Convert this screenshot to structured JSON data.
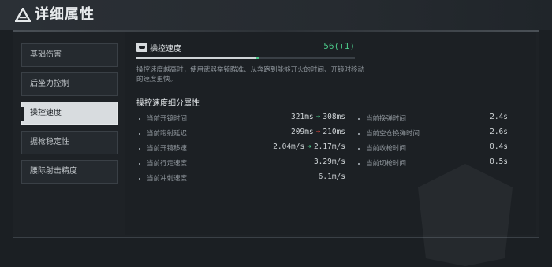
{
  "header": {
    "title": "详细属性",
    "icon": "warning-triangle-icon"
  },
  "sidebar": {
    "items": [
      {
        "label": "基础伤害",
        "active": false
      },
      {
        "label": "后坐力控制",
        "active": false
      },
      {
        "label": "操控速度",
        "active": true
      },
      {
        "label": "据枪稳定性",
        "active": false
      },
      {
        "label": "腰际射击精度",
        "active": false
      }
    ]
  },
  "stat": {
    "icon": "handling-icon",
    "name": "操控速度",
    "value": "56(+1)",
    "base_fraction": 0.55,
    "bonus_fraction": 0.01,
    "description": "操控速度越高时，使用武器举镜瞄准、从奔跑到能够开火的时间、开镜时移动的速度更快。"
  },
  "breakdown": {
    "title": "操控速度细分属性",
    "left": [
      {
        "label": "当前开镜时间",
        "from": "321ms",
        "to": "308ms",
        "trend": "up"
      },
      {
        "label": "当前跑射延迟",
        "from": "209ms",
        "to": "210ms",
        "trend": "down"
      },
      {
        "label": "当前开镜移速",
        "from": "2.04m/s",
        "to": "2.17m/s",
        "trend": "up"
      },
      {
        "label": "当前行走速度",
        "value": "3.29m/s"
      },
      {
        "label": "当前冲刺速度",
        "value": "6.1m/s"
      }
    ],
    "right": [
      {
        "label": "当前换弹时间",
        "value": "2.4s"
      },
      {
        "label": "当前空仓换弹时间",
        "value": "2.6s"
      },
      {
        "label": "当前收枪时间",
        "value": "0.4s"
      },
      {
        "label": "当前切枪时间",
        "value": "0.5s"
      }
    ]
  },
  "colors": {
    "accent_green": "#4cc98a",
    "accent_red": "#e0483e",
    "active_tab": "#d8dcdf"
  }
}
